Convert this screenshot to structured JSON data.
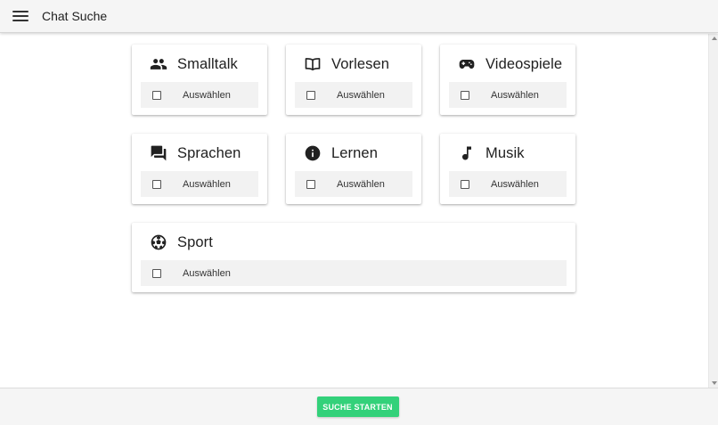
{
  "appbar": {
    "title": "Chat Suche",
    "menu_icon": "hamburger-menu-icon"
  },
  "categories": [
    {
      "title": "Smalltalk",
      "icon": "people-icon",
      "select_label": "Auswählen",
      "selected": false
    },
    {
      "title": "Vorlesen",
      "icon": "book-icon",
      "select_label": "Auswählen",
      "selected": false
    },
    {
      "title": "Videospiele",
      "icon": "gamepad-icon",
      "select_label": "Auswählen",
      "selected": false
    },
    {
      "title": "Sprachen",
      "icon": "chat-bubbles-icon",
      "select_label": "Auswählen",
      "selected": false
    },
    {
      "title": "Lernen",
      "icon": "info-icon",
      "select_label": "Auswählen",
      "selected": false
    },
    {
      "title": "Musik",
      "icon": "music-note-icon",
      "select_label": "Auswählen",
      "selected": false
    },
    {
      "title": "Sport",
      "icon": "soccer-ball-icon",
      "select_label": "Auswählen",
      "selected": false
    }
  ],
  "footer": {
    "start_label": "SUCHE STARTEN"
  },
  "colors": {
    "accent": "#33d17a",
    "appbar_bg": "#f5f5f5",
    "select_row_bg": "#f2f2f2"
  }
}
